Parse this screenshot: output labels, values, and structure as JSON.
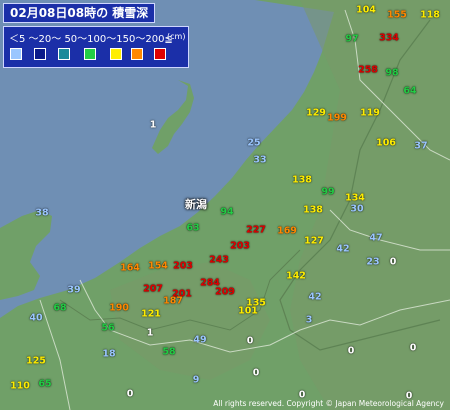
{
  "title": "02月08日08時の 積雪深",
  "legend": {
    "scale_text": "＜5 〜20〜 50〜100〜150〜200≦",
    "unit": "(cm)",
    "colors": [
      "#9ac6ff",
      "#0a1a8a",
      "#1a8a9a",
      "#22cc44",
      "#ffee00",
      "#ff8800",
      "#dd0000"
    ]
  },
  "city_label": "新潟",
  "copyright": "All rights reserved. Copyright © Japan Meteorological Agency",
  "colors": {
    "sea": "#6f8fb4",
    "land": "#70a068",
    "mountain": "#7a9968",
    "ridge": "#5e8354"
  },
  "stations": [
    {
      "value": "104",
      "color": "#ffee00"
    },
    {
      "value": "155",
      "color": "#ff8800"
    },
    {
      "value": "118",
      "color": "#ffee00"
    },
    {
      "value": "97",
      "color": "#22cc44"
    },
    {
      "value": "334",
      "color": "#dd0000"
    },
    {
      "value": "258",
      "color": "#dd0000"
    },
    {
      "value": "98",
      "color": "#22cc44"
    },
    {
      "value": "64",
      "color": "#22cc44"
    },
    {
      "value": "129",
      "color": "#ffee00"
    },
    {
      "value": "199",
      "color": "#ff8800"
    },
    {
      "value": "119",
      "color": "#ffee00"
    },
    {
      "value": "106",
      "color": "#ffee00"
    },
    {
      "value": "37",
      "color": "#9ac6ff"
    },
    {
      "value": "25",
      "color": "#9ac6ff"
    },
    {
      "value": "33",
      "color": "#9ac6ff"
    },
    {
      "value": "1",
      "color": "#ffffff"
    },
    {
      "value": "138",
      "color": "#ffee00"
    },
    {
      "value": "99",
      "color": "#22cc44"
    },
    {
      "value": "138",
      "color": "#ffee00"
    },
    {
      "value": "134",
      "color": "#ffee00"
    },
    {
      "value": "30",
      "color": "#9ac6ff"
    },
    {
      "value": "94",
      "color": "#22cc44"
    },
    {
      "value": "38",
      "color": "#9ac6ff"
    },
    {
      "value": "63",
      "color": "#22cc44"
    },
    {
      "value": "227",
      "color": "#dd0000"
    },
    {
      "value": "169",
      "color": "#ff8800"
    },
    {
      "value": "203",
      "color": "#dd0000"
    },
    {
      "value": "127",
      "color": "#ffee00"
    },
    {
      "value": "42",
      "color": "#9ac6ff"
    },
    {
      "value": "47",
      "color": "#9ac6ff"
    },
    {
      "value": "23",
      "color": "#9ac6ff"
    },
    {
      "value": "0",
      "color": "#ffffff"
    },
    {
      "value": "164",
      "color": "#ff8800"
    },
    {
      "value": "154",
      "color": "#ff8800"
    },
    {
      "value": "203",
      "color": "#dd0000"
    },
    {
      "value": "243",
      "color": "#dd0000"
    },
    {
      "value": "142",
      "color": "#ffee00"
    },
    {
      "value": "39",
      "color": "#9ac6ff"
    },
    {
      "value": "207",
      "color": "#dd0000"
    },
    {
      "value": "284",
      "color": "#dd0000"
    },
    {
      "value": "209",
      "color": "#dd0000"
    },
    {
      "value": "201",
      "color": "#dd0000"
    },
    {
      "value": "187",
      "color": "#ff8800"
    },
    {
      "value": "42",
      "color": "#9ac6ff"
    },
    {
      "value": "135",
      "color": "#ffee00"
    },
    {
      "value": "40",
      "color": "#9ac6ff"
    },
    {
      "value": "68",
      "color": "#22cc44"
    },
    {
      "value": "190",
      "color": "#ff8800"
    },
    {
      "value": "121",
      "color": "#ffee00"
    },
    {
      "value": "101",
      "color": "#ffee00"
    },
    {
      "value": "3",
      "color": "#9ac6ff"
    },
    {
      "value": "56",
      "color": "#22cc44"
    },
    {
      "value": "1",
      "color": "#ffffff"
    },
    {
      "value": "49",
      "color": "#9ac6ff"
    },
    {
      "value": "0",
      "color": "#ffffff"
    },
    {
      "value": "18",
      "color": "#9ac6ff"
    },
    {
      "value": "58",
      "color": "#22cc44"
    },
    {
      "value": "125",
      "color": "#ffee00"
    },
    {
      "value": "0",
      "color": "#ffffff"
    },
    {
      "value": "0",
      "color": "#ffffff"
    },
    {
      "value": "9",
      "color": "#9ac6ff"
    },
    {
      "value": "0",
      "color": "#ffffff"
    },
    {
      "value": "110",
      "color": "#ffee00"
    },
    {
      "value": "65",
      "color": "#22cc44"
    },
    {
      "value": "0",
      "color": "#ffffff"
    },
    {
      "value": "0",
      "color": "#ffffff"
    },
    {
      "value": "0",
      "color": "#ffffff"
    }
  ]
}
